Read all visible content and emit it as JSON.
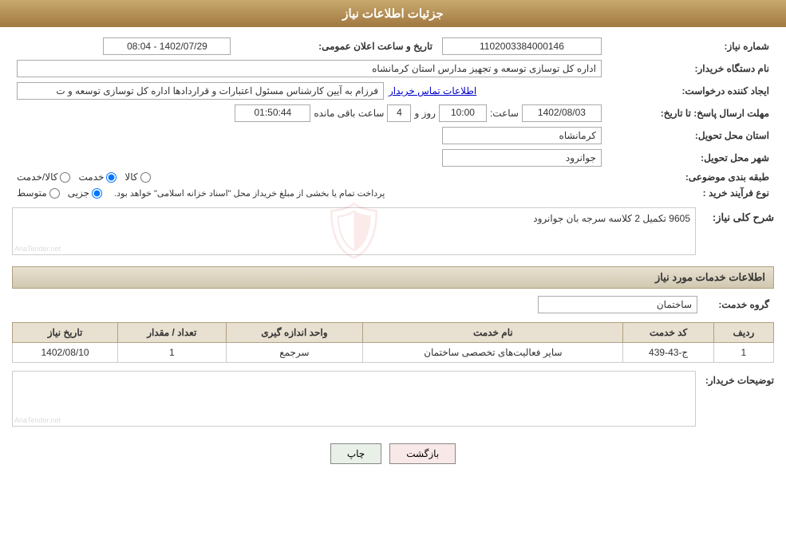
{
  "header": {
    "title": "جزئیات اطلاعات نیاز"
  },
  "fields": {
    "shomara_niaz_label": "شماره نیاز:",
    "shomara_niaz_value": "1102003384000146",
    "nam_dastgah_label": "نام دستگاه خریدار:",
    "nam_dastgah_value": "اداره کل توسازی  توسعه و تجهیز مدارس استان کرمانشاه",
    "ijad_konande_label": "ایجاد کننده درخواست:",
    "ijad_konande_value": "فرزام به آیین کارشناس مسئول اعتبارات و قراردادها اداره کل توسازی  توسعه و ت",
    "ijad_konande_link": "اطلاعات تماس خریدار",
    "mohlet_ersal_label": "مهلت ارسال پاسخ: تا تاریخ:",
    "date_value": "1402/08/03",
    "saat_label": "ساعت:",
    "saat_value": "10:00",
    "rooz_label": "روز و",
    "rooz_value": "4",
    "baqi_mande_label": "ساعت باقی مانده",
    "baqi_mande_value": "01:50:44",
    "ostan_label": "استان محل تحویل:",
    "ostan_value": "کرمانشاه",
    "shahr_label": "شهر محل تحویل:",
    "shahr_value": "جوانرود",
    "tabaqe_bandi_label": "طبقه بندی موضوعی:",
    "radio_kala": "کالا",
    "radio_khedmat": "خدمت",
    "radio_kala_khedmat": "کالا/خدمت",
    "radio_selected": "khedmat",
    "noe_farayand_label": "نوع فرآیند خرید :",
    "radio_jozii": "جزیی",
    "radio_motavasset": "متوسط",
    "purchase_note": "پرداخت تمام یا بخشی از مبلغ خریداز محل \"اسناد خزانه اسلامی\" خواهد بود.",
    "sharh_label": "شرح کلی نیاز:",
    "sharh_value": "9605 تکمیل 2 کلاسه سرجه بان جوانرود",
    "services_label": "اطلاعات خدمات مورد نیاز",
    "group_label": "گروه خدمت:",
    "group_value": "ساختمان",
    "table_headers": {
      "radif": "ردیف",
      "code_khedmat": "کد خدمت",
      "name_khedmat": "نام خدمت",
      "vahed": "واحد اندازه گیری",
      "tedad": "تعداد / مقدار",
      "tarikh": "تاریخ نیاز"
    },
    "table_rows": [
      {
        "radif": "1",
        "code_khedmat": "ج-43-439",
        "name_khedmat": "سایر فعالیت‌های تخصصی ساختمان",
        "vahed": "سرجمع",
        "tedad": "1",
        "tarikh": "1402/08/10"
      }
    ],
    "توضیحات_label": "توضیحات خریدار:",
    "tashkil_label": "تاریخ و ساعت اعلان عمومی:",
    "tashkil_value": "1402/07/29 - 08:04",
    "btn_print": "چاپ",
    "btn_back": "بازگشت"
  }
}
